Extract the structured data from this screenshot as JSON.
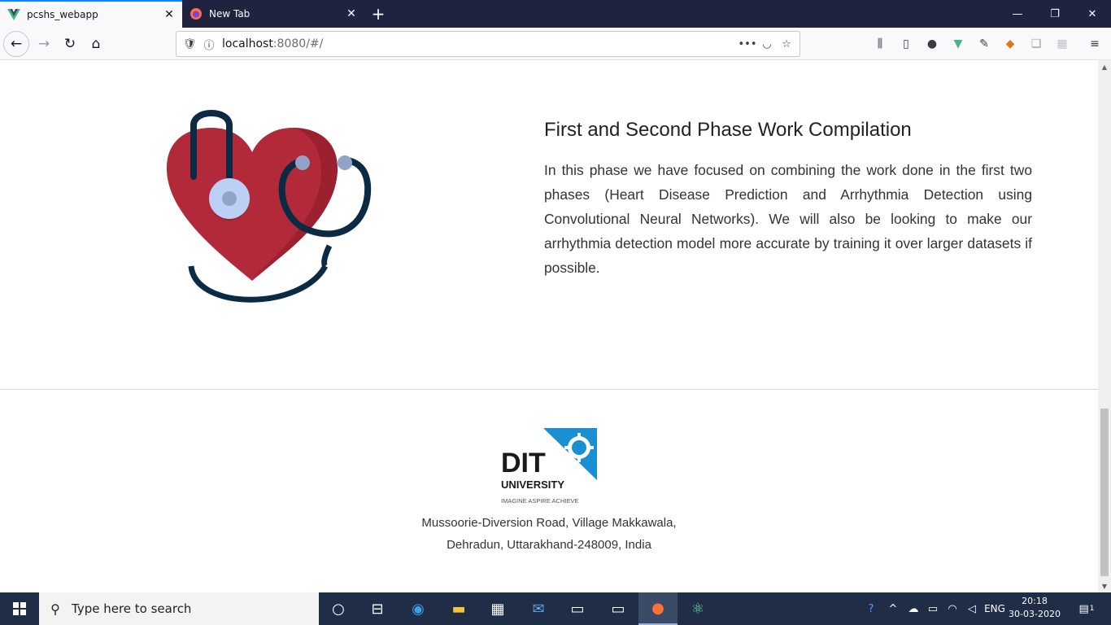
{
  "browser": {
    "tabs": [
      {
        "title": "pcshs_webapp",
        "active": true
      },
      {
        "title": "New Tab",
        "active": false
      }
    ],
    "url_host": "localhost",
    "url_rest": ":8080/#/",
    "accent": "#0a84ff",
    "tabstrip_color": "#202340"
  },
  "section": {
    "title": "First and Second Phase Work Compilation",
    "body": "In this phase we have focused on combining the work done in the first two phases (Heart Disease Prediction and Arrhythmia Detection using Convolutional Neural Networks). We will also be looking to make our arrhythmia detection model more accurate by training it over larger datasets if possible.",
    "illustration": "heart-stethoscope-icon",
    "heart_color": "#b22a3a",
    "tube_color": "#0d2a44"
  },
  "footer": {
    "logo": {
      "wordmark": "DIT",
      "subtitle": "UNIVERSITY",
      "tagline": "IMAGINE   ASPIRE   ACHIEVE",
      "accent": "#1a8fd1"
    },
    "address_line1": "Mussoorie-Diversion Road, Village Makkawala,",
    "address_line2": "Dehradun, Uttarakhand-248009, India"
  },
  "taskbar": {
    "search_placeholder": "Type here to search",
    "language": "ENG",
    "time": "20:18",
    "date": "30-03-2020",
    "notification_count": "1"
  }
}
